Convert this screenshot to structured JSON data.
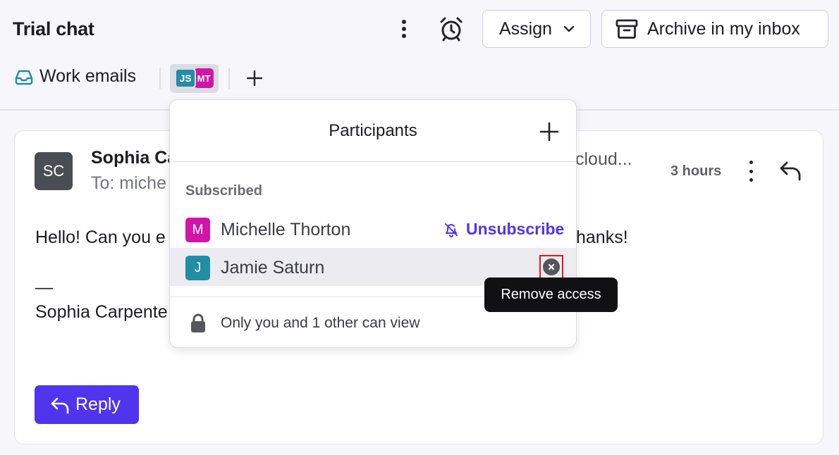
{
  "header": {
    "title": "Trial chat",
    "assign_label": "Assign",
    "archive_label": "Archive in my inbox",
    "inbox_label": "Work emails",
    "avatar_initials": [
      "JS",
      "MT"
    ]
  },
  "message": {
    "sender_avatar": "SC",
    "sender_name_visible": "Sophia Ca",
    "to_visible": "To: miche",
    "subject_tail": "cloud...",
    "time": "3 hours",
    "body_start": "Hello! Can you e",
    "body_end": "hanks!",
    "dash": "—",
    "signature_visible": "Sophia Carpente",
    "reply_label": "Reply"
  },
  "popover": {
    "title": "Participants",
    "section_label": "Subscribed",
    "participants": [
      {
        "initial": "M",
        "name": "Michelle Thorton",
        "color": "#d215a8",
        "action": "Unsubscribe"
      },
      {
        "initial": "J",
        "name": "Jamie Saturn",
        "color": "#238da3"
      }
    ],
    "privacy_text": "Only you and 1 other can view"
  },
  "tooltip": {
    "text": "Remove access"
  },
  "colors": {
    "accent": "#5034ee",
    "highlight": "#e01818"
  }
}
